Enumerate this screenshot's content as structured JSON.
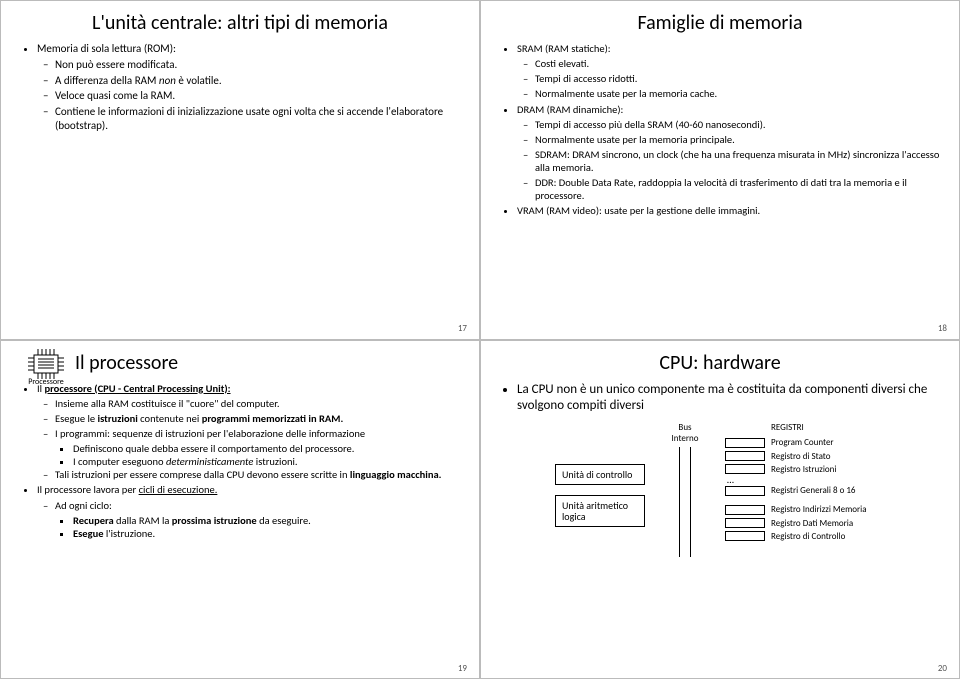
{
  "slide17": {
    "title": "L'unità centrale: altri tipi di memoria",
    "b1": "Memoria di sola lettura (ROM):",
    "s1": "Non può essere modificata.",
    "s2a": "A differenza della RAM ",
    "s2b": "non",
    "s2c": " è volatile.",
    "s3": "Veloce quasi come la RAM.",
    "s4": "Contiene le informazioni di inizializzazione usate ogni volta che si accende l'elaboratore (bootstrap).",
    "page": "17"
  },
  "slide18": {
    "title": "Famiglie di memoria",
    "b1": "SRAM (RAM statiche):",
    "s1": "Costi elevati.",
    "s2": "Tempi di accesso ridotti.",
    "s3": "Normalmente usate per la memoria cache.",
    "b2": "DRAM (RAM dinamiche):",
    "s4": "Tempi di accesso più della SRAM (40-60 nanosecondi).",
    "s5": "Normalmente usate per la memoria principale.",
    "s6": "SDRAM: DRAM sincrono, un clock (che ha una frequenza misurata in MHz) sincronizza l'accesso alla memoria.",
    "s7": "DDR: Double Data Rate, raddoppia la velocità di trasferimento di dati tra la memoria e il processore.",
    "b3": "VRAM (RAM video): usate per la gestione delle immagini.",
    "page": "18"
  },
  "slide19": {
    "title": "Il processore",
    "chip": "Processore",
    "b1a": "Il ",
    "b1b": "processore (CPU - Central Processing Unit):",
    "s1": "Insieme alla RAM costituisce il \"cuore\" del computer.",
    "s2a": "Esegue le ",
    "s2b": "istruzioni",
    "s2c": " contenute nei ",
    "s2d": "programmi memorizzati in RAM.",
    "s3": "I programmi: sequenze di istruzioni per l'elaborazione delle informazione",
    "t1": "Definiscono quale debba essere il comportamento del processore.",
    "t2a": "I computer eseguono ",
    "t2b": "deterministicamente",
    "t2c": " istruzioni.",
    "s4a": "Tali istruzioni per essere comprese dalla CPU devono essere scritte in ",
    "s4b": "linguaggio macchina.",
    "b2a": "Il processore lavora per ",
    "b2b": "cicli di esecuzione.",
    "s5": "Ad ogni ciclo:",
    "t3a": "Recupera",
    "t3b": " dalla RAM la ",
    "t3c": "prossima istruzione",
    "t3d": " da eseguire.",
    "t4a": "Esegue",
    "t4b": " l'istruzione.",
    "page": "19"
  },
  "slide20": {
    "title": "CPU: hardware",
    "lead": "La CPU non è un unico componente ma è costituita da componenti diversi che svolgono compiti diversi",
    "bus": "Bus Interno",
    "uc": "Unità di controllo",
    "ual": "Unità aritmetico logica",
    "reglabel": "REGISTRI",
    "r1": "Program Counter",
    "r2": "Registro di Stato",
    "r3": "Registro Istruzioni",
    "dots": "…",
    "r4": "Registri Generali 8 o 16",
    "r5": "Registro Indirizzi Memoria",
    "r6": "Registro Dati Memoria",
    "r7": "Registro di Controllo",
    "page": "20"
  }
}
